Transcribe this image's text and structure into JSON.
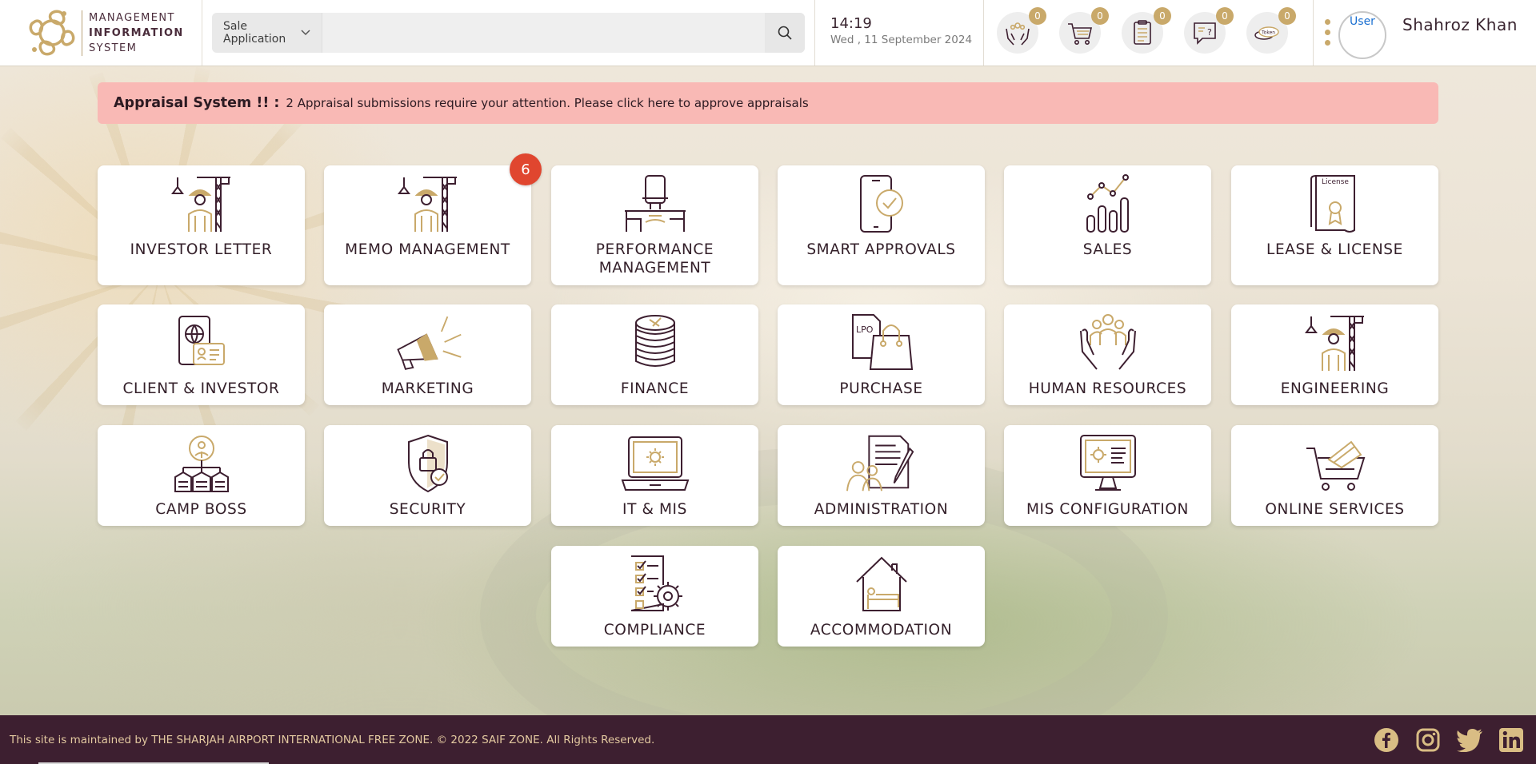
{
  "header": {
    "logo": {
      "line1": "MANAGEMENT",
      "line2": "INFORMATION",
      "line3": "SYSTEM"
    },
    "search": {
      "selected_app": "Sale Application",
      "placeholder": ""
    },
    "clock": {
      "time": "14:19",
      "date": "Wed , 11 September 2024"
    },
    "notifications": [
      {
        "icon": "hands-people-icon",
        "count": "0"
      },
      {
        "icon": "shopping-cart-icon",
        "count": "0"
      },
      {
        "icon": "clipboard-list-icon",
        "count": "0"
      },
      {
        "icon": "chat-question-icon",
        "count": "0"
      },
      {
        "icon": "token-coins-icon",
        "count": "0",
        "icon_text": "Token"
      }
    ],
    "user": {
      "name": "Shahroz Khan",
      "avatar_alt": "User"
    }
  },
  "alert": {
    "title": "Appraisal System !! :",
    "message": "2 Appraisal submissions require your attention. Please click here to approve appraisals"
  },
  "tiles": [
    {
      "label": "INVESTOR LETTER",
      "icon": "construction-worker-crane-icon"
    },
    {
      "label": "MEMO MANAGEMENT",
      "icon": "construction-worker-crane-icon",
      "badge": "6"
    },
    {
      "label": "PERFORMANCE MANAGEMENT",
      "icon": "office-desk-chair-icon"
    },
    {
      "label": "SMART APPROVALS",
      "icon": "smartphone-check-icon"
    },
    {
      "label": "SALES",
      "icon": "bar-chart-trend-icon"
    },
    {
      "label": "LEASE & LICENSE",
      "icon": "license-document-icon",
      "icon_text": "License"
    },
    {
      "label": "CLIENT & INVESTOR",
      "icon": "passport-id-card-icon"
    },
    {
      "label": "MARKETING",
      "icon": "megaphone-icon"
    },
    {
      "label": "FINANCE",
      "icon": "coin-stack-icon"
    },
    {
      "label": "PURCHASE",
      "icon": "lpo-shopping-bag-icon",
      "icon_text": "LPO"
    },
    {
      "label": "HUMAN RESOURCES",
      "icon": "people-in-hands-icon"
    },
    {
      "label": "ENGINEERING",
      "icon": "construction-worker-crane-icon"
    },
    {
      "label": "CAMP BOSS",
      "icon": "camp-buildings-icon"
    },
    {
      "label": "SECURITY",
      "icon": "shield-lock-icon"
    },
    {
      "label": "IT & MIS",
      "icon": "laptop-gear-icon"
    },
    {
      "label": "ADMINISTRATION",
      "icon": "people-document-icon"
    },
    {
      "label": "MIS CONFIGURATION",
      "icon": "monitor-gear-icon"
    },
    {
      "label": "ONLINE SERVICES",
      "icon": "cart-card-icon"
    },
    {
      "label": "COMPLIANCE",
      "icon": "checklist-gear-icon"
    },
    {
      "label": "ACCOMMODATION",
      "icon": "house-bed-icon"
    }
  ],
  "footer": {
    "text": "This site is maintained by THE SHARJAH AIRPORT INTERNATIONAL FREE ZONE. © 2022 SAIF ZONE. All Rights Reserved.",
    "social": [
      "facebook-icon",
      "instagram-icon",
      "twitter-icon",
      "linkedin-icon"
    ]
  },
  "colors": {
    "brand_plum": "#3d1f30",
    "brand_gold": "#c9a96a",
    "alert_bg": "#f9b9b5",
    "badge_red": "#e0462f"
  }
}
